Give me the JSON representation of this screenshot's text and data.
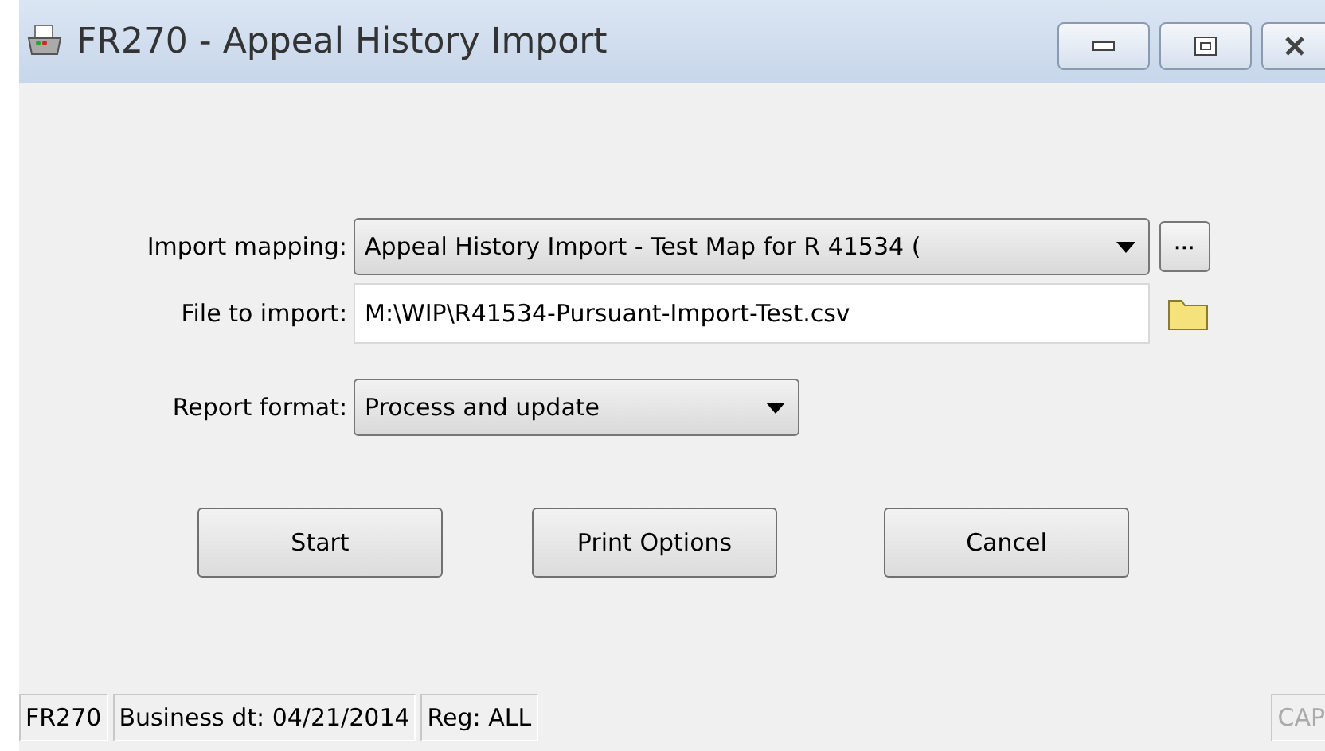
{
  "window": {
    "title": "FR270 - Appeal History Import"
  },
  "form": {
    "import_mapping": {
      "label": "Import mapping:",
      "value": "Appeal History Import - Test Map for R 41534 (",
      "browse": "···"
    },
    "file_to_import": {
      "label": "File to import:",
      "value": "M:\\WIP\\R41534-Pursuant-Import-Test.csv"
    },
    "report_format": {
      "label": "Report format:",
      "value": "Process and update"
    }
  },
  "buttons": [
    "Start",
    "Print Options",
    "Cancel"
  ],
  "status_bar": {
    "panels": [
      "FR270",
      "Business dt: 04/21/2014",
      "Reg: ALL"
    ],
    "caps": {
      "text": "CAP",
      "on": false
    }
  }
}
